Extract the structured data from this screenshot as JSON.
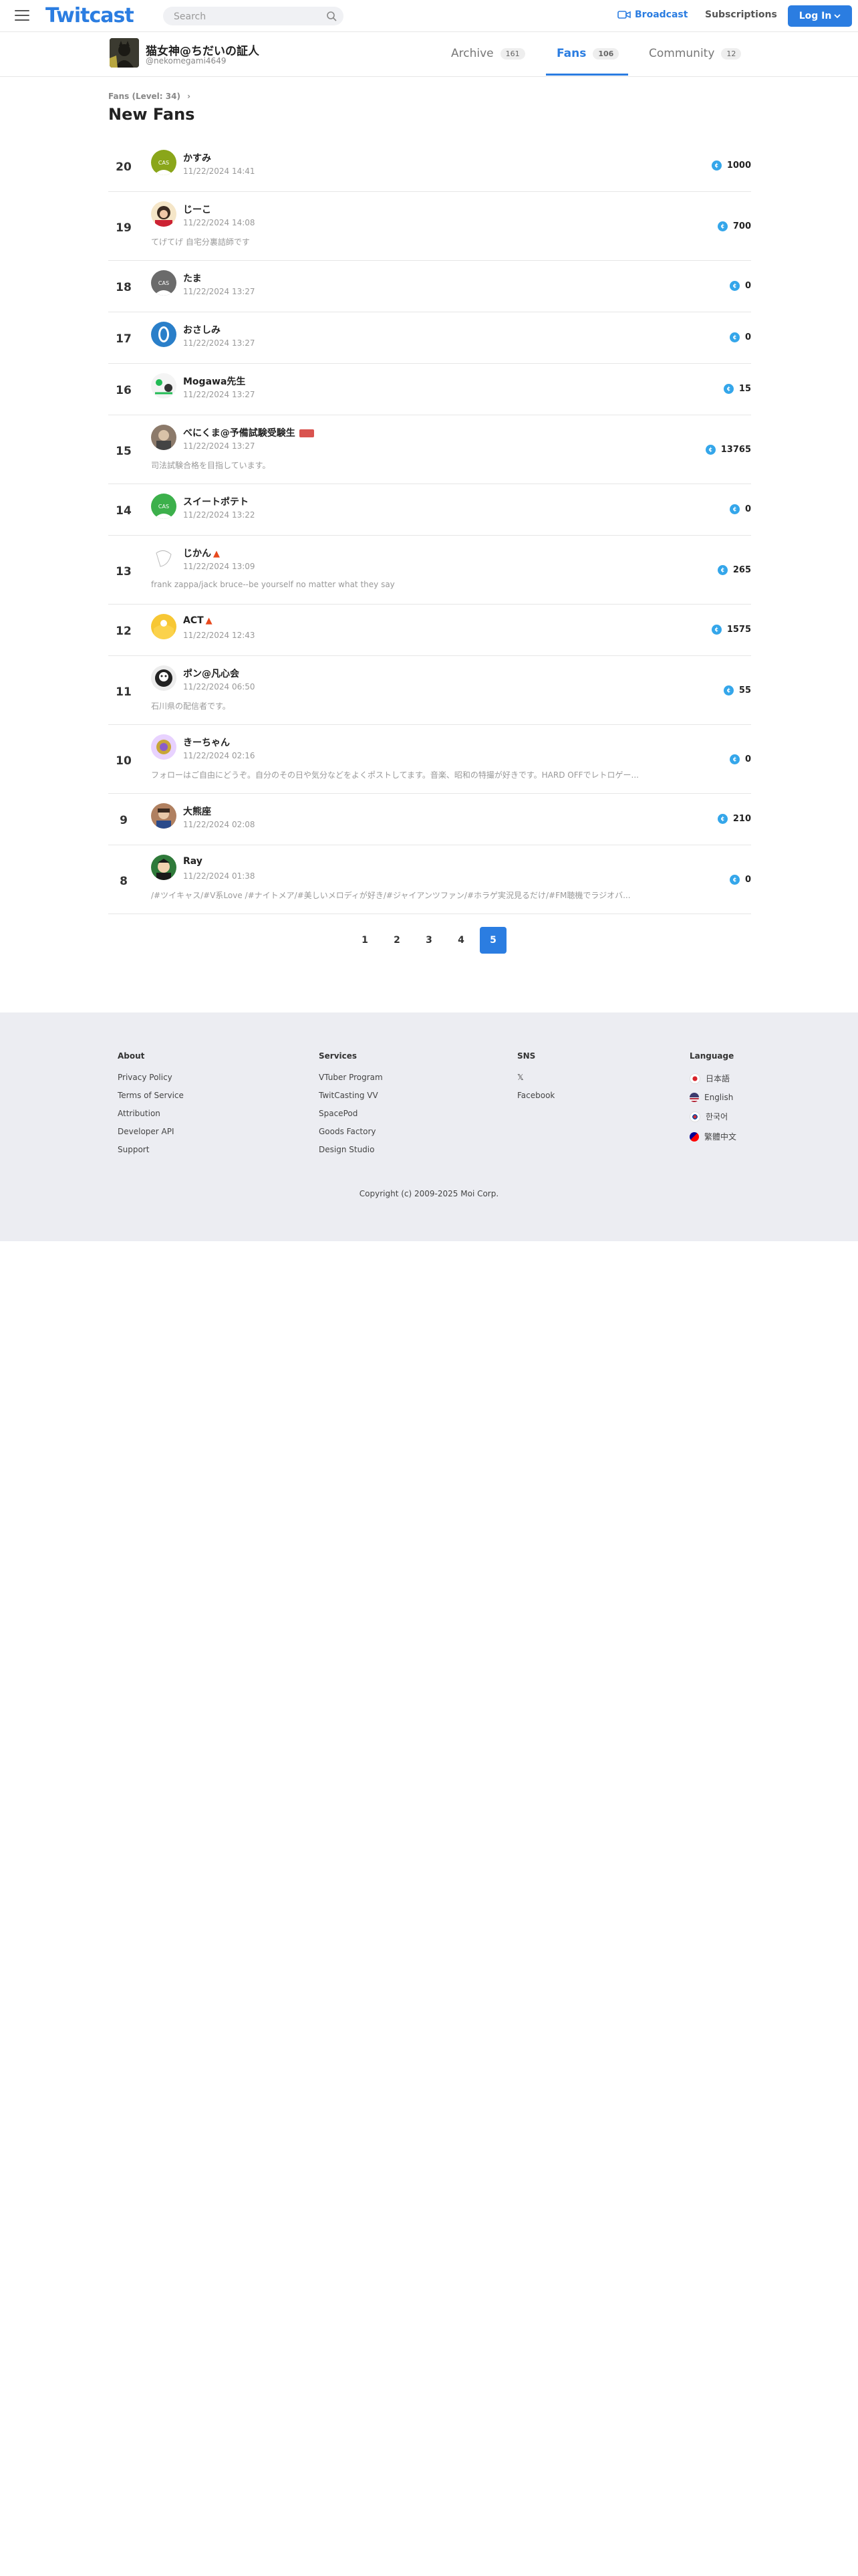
{
  "header": {
    "logo": "Twitcast",
    "search_placeholder": "Search",
    "broadcast_label": "Broadcast",
    "subscriptions_label": "Subscriptions",
    "login_label": "Log In"
  },
  "profile": {
    "name": "猫女神@ちだいの証人",
    "handle": "@nekomegami4649",
    "tabs": [
      {
        "label": "Archive",
        "count": "161"
      },
      {
        "label": "Fans",
        "count": "106"
      },
      {
        "label": "Community",
        "count": "12"
      }
    ]
  },
  "breadcrumb": "Fans (Level: 34)",
  "page_title": "New Fans",
  "fans": [
    {
      "rank": "20",
      "name": "かすみ",
      "date": "11/22/2024 14:41",
      "bio": "",
      "score": "1000"
    },
    {
      "rank": "19",
      "name": "じーこ",
      "date": "11/22/2024 14:08",
      "bio": "てげてげ 自宅分裏詰師です",
      "score": "700"
    },
    {
      "rank": "18",
      "name": "たま",
      "date": "11/22/2024 13:27",
      "bio": "",
      "score": "0"
    },
    {
      "rank": "17",
      "name": "おさしみ",
      "date": "11/22/2024 13:27",
      "bio": "",
      "score": "0"
    },
    {
      "rank": "16",
      "name": "Mogawa先生",
      "date": "11/22/2024 13:27",
      "bio": "",
      "score": "15"
    },
    {
      "rank": "15",
      "name": "べにくま@予備試験受験生",
      "date": "11/22/2024 13:27",
      "bio": "司法試験合格を目指しています。",
      "score": "13765"
    },
    {
      "rank": "14",
      "name": "スイートポテト",
      "date": "11/22/2024 13:22",
      "bio": "",
      "score": "0"
    },
    {
      "rank": "13",
      "name": "じかん",
      "date": "11/22/2024 13:09",
      "bio": "frank zappa/jack bruce--be yourself no matter what they say",
      "score": "265"
    },
    {
      "rank": "12",
      "name": "ACT",
      "date": "11/22/2024 12:43",
      "bio": "",
      "score": "1575"
    },
    {
      "rank": "11",
      "name": "ポン@凡心会",
      "date": "11/22/2024 06:50",
      "bio": "石川県の配信者です。",
      "score": "55"
    },
    {
      "rank": "10",
      "name": "きーちゃん",
      "date": "11/22/2024 02:16",
      "bio": "フォローはご自由にどうぞ。自分のその日や気分などをよくポストしてます。音楽、昭和の特撮が好きです。HARD OFFでレトロゲー...",
      "score": "0"
    },
    {
      "rank": "9",
      "name": "大熊座",
      "date": "11/22/2024 02:08",
      "bio": "",
      "score": "210"
    },
    {
      "rank": "8",
      "name": "Ray",
      "date": "11/22/2024 01:38",
      "bio": "/#ツイキャス/#V系Love /#ナイトメア/#美しいメロディが好き/#ジャイアンツファン/#ホラゲ実況見るだけ/#FM聴機でラジオバ...",
      "score": "0"
    }
  ],
  "pagination": [
    "1",
    "2",
    "3",
    "4",
    "5"
  ],
  "pagination_active": "5",
  "footer": {
    "about_head": "About",
    "about": [
      "Privacy Policy",
      "Terms of Service",
      "Attribution",
      "Developer API",
      "Support"
    ],
    "services_head": "Services",
    "services": [
      "VTuber Program",
      "TwitCasting VV",
      "SpacePod",
      "Goods Factory",
      "Design Studio"
    ],
    "sns_head": "SNS",
    "sns": [
      "𝕏",
      "Facebook"
    ],
    "language_head": "Language",
    "languages": [
      "日本語",
      "English",
      "한국어",
      "繁體中文"
    ],
    "copyright": "Copyright (c) 2009-2025 Moi Corp."
  }
}
